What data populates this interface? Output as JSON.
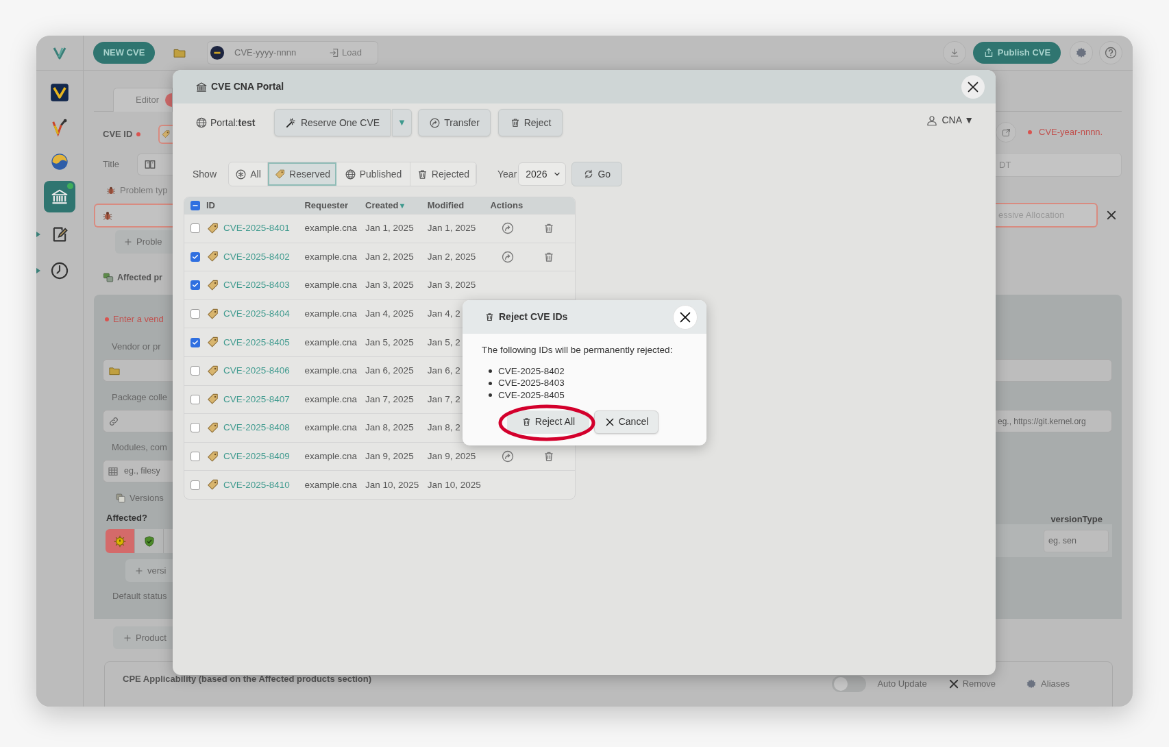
{
  "app": {
    "toolbar": {
      "new_button": "NEW CVE",
      "id_placeholder": "CVE-yyyy-nnnn",
      "load_button": "Load",
      "publish_button": "Publish CVE"
    },
    "sidebar": [
      {
        "kind": "logo",
        "selected": false,
        "expander": false
      },
      {
        "kind": "vulnogram",
        "selected": false,
        "expander": false
      },
      {
        "kind": "swirl",
        "selected": false,
        "expander": false
      },
      {
        "kind": "portal",
        "selected": true,
        "expander": false
      },
      {
        "kind": "notes",
        "selected": false,
        "expander": true
      },
      {
        "kind": "history",
        "selected": false,
        "expander": true
      }
    ],
    "editor_tab": "Editor",
    "left": {
      "cve_id_label": "CVE ID",
      "title_label": "Title",
      "problem_label": "Problem typ",
      "add_problem": "Proble",
      "affected_label": "Affected pr",
      "vendor_hint": "Enter a vend",
      "vendor_label": "Vendor or pr",
      "package_label": "Package colle",
      "modules_label": "Modules, com",
      "modules_placeholder": "eg., filesy",
      "versions_label": "Versions",
      "affected_q": "Affected?",
      "add_version": "versi",
      "default_status": "Default status",
      "add_product": "Product"
    },
    "right": {
      "id_hint": "CVE-year-nnnn.",
      "title_value": "DT",
      "problem_value": "essive Allocation",
      "repo_placeholder": "eg., https://git.kernel.org",
      "version_type_label": "versionType",
      "version_type_placeholder": "eg. sen"
    },
    "cpe": {
      "title": "CPE Applicability (based on the Affected products section)",
      "auto_update": {
        "label": "Auto Update",
        "on": false
      },
      "remove": "Remove",
      "aliases": "Aliases"
    }
  },
  "portal": {
    "title": "CVE CNA Portal",
    "portal_label": "Portal:**test**",
    "reserve_button": "Reserve One CVE",
    "reserve_caret": "▼",
    "transfer_button": "Transfer",
    "reject_button": "Reject",
    "user_menu": "CNA ▼",
    "show_label": "Show",
    "filters": [
      {
        "kind": "all",
        "label": "All",
        "selected": false
      },
      {
        "kind": "reserved",
        "label": "Reserved",
        "selected": true
      },
      {
        "kind": "published",
        "label": "Published",
        "selected": false
      },
      {
        "kind": "rejected",
        "label": "Rejected",
        "selected": false
      }
    ],
    "year_label": "Year",
    "year_value": "2026",
    "go_button": "Go",
    "table": {
      "select_all_partial": true,
      "columns": [
        {
          "label": "ID"
        },
        {
          "label": "Requester"
        },
        {
          "label": "Created",
          "sort_mark": "▼"
        },
        {
          "label": "Modified"
        },
        {
          "label": "Actions"
        }
      ],
      "rows": [
        {
          "id": "CVE-2025-8401",
          "requester": "example.cna",
          "created": "Jan 1, 2025",
          "modified": "Jan 1, 2025",
          "checked": false
        },
        {
          "id": "CVE-2025-8402",
          "requester": "example.cna",
          "created": "Jan 2, 2025",
          "modified": "Jan 2, 2025",
          "checked": true
        },
        {
          "id": "CVE-2025-8403",
          "requester": "example.cna",
          "created": "Jan 3, 2025",
          "modified": "Jan 3, 2025",
          "checked": true
        },
        {
          "id": "CVE-2025-8404",
          "requester": "example.cna",
          "created": "Jan 4, 2025",
          "modified": "Jan 4, 2",
          "checked": false
        },
        {
          "id": "CVE-2025-8405",
          "requester": "example.cna",
          "created": "Jan 5, 2025",
          "modified": "Jan 5, 2",
          "checked": true
        },
        {
          "id": "CVE-2025-8406",
          "requester": "example.cna",
          "created": "Jan 6, 2025",
          "modified": "Jan 6, 2",
          "checked": false
        },
        {
          "id": "CVE-2025-8407",
          "requester": "example.cna",
          "created": "Jan 7, 2025",
          "modified": "Jan 7, 2",
          "checked": false
        },
        {
          "id": "CVE-2025-8408",
          "requester": "example.cna",
          "created": "Jan 8, 2025",
          "modified": "Jan 8, 2",
          "checked": false
        },
        {
          "id": "CVE-2025-8409",
          "requester": "example.cna",
          "created": "Jan 9, 2025",
          "modified": "Jan 9, 2025",
          "checked": false
        },
        {
          "id": "CVE-2025-8410",
          "requester": "example.cna",
          "created": "Jan 10, 2025",
          "modified": "Jan 10, 2025",
          "checked": false
        }
      ]
    }
  },
  "reject_dialog": {
    "title": "Reject CVE IDs",
    "message": "The following IDs will be permanently rejected:",
    "ids": [
      "CVE-2025-8402",
      "CVE-2025-8403",
      "CVE-2025-8405"
    ],
    "confirm_button": "Reject All",
    "cancel_button": "Cancel",
    "highlighted": true
  }
}
